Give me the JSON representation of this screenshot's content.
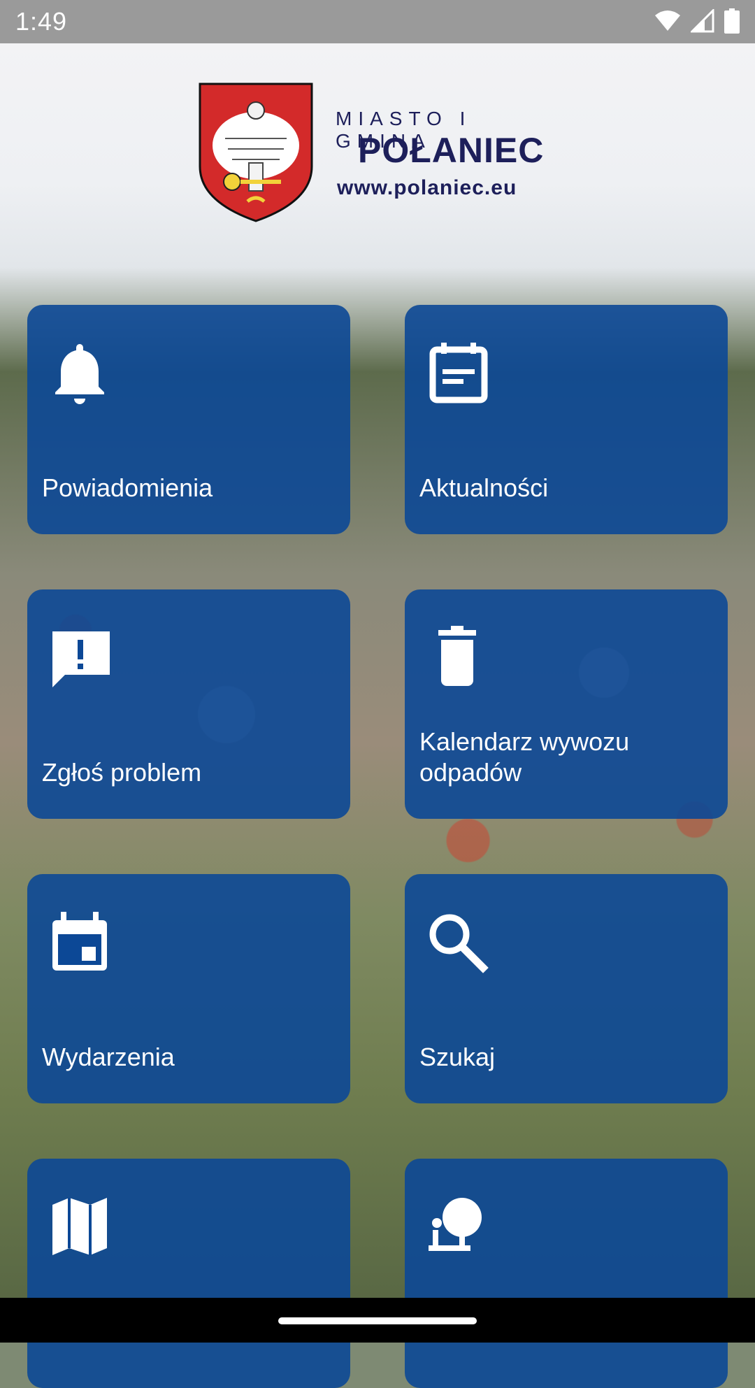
{
  "status_bar": {
    "time": "1:49"
  },
  "logo": {
    "line1": "MIASTO I GMINA",
    "line2": "POŁANIEC",
    "line3": "www.polaniec.eu"
  },
  "tiles": [
    {
      "label": "Powiadomienia",
      "icon": "bell-icon"
    },
    {
      "label": "Aktualności",
      "icon": "news-icon"
    },
    {
      "label": "Zgłoś problem",
      "icon": "report-problem-icon"
    },
    {
      "label": "Kalendarz wywozu odpadów",
      "icon": "trash-icon"
    },
    {
      "label": "Wydarzenia",
      "icon": "calendar-event-icon"
    },
    {
      "label": "Szukaj",
      "icon": "search-icon"
    },
    {
      "label": "",
      "icon": "map-icon"
    },
    {
      "label": "",
      "icon": "park-icon"
    }
  ],
  "colors": {
    "tile": "#0c4896",
    "status_bar": "#9a9a9a",
    "logo_text": "#1d1f5a"
  }
}
